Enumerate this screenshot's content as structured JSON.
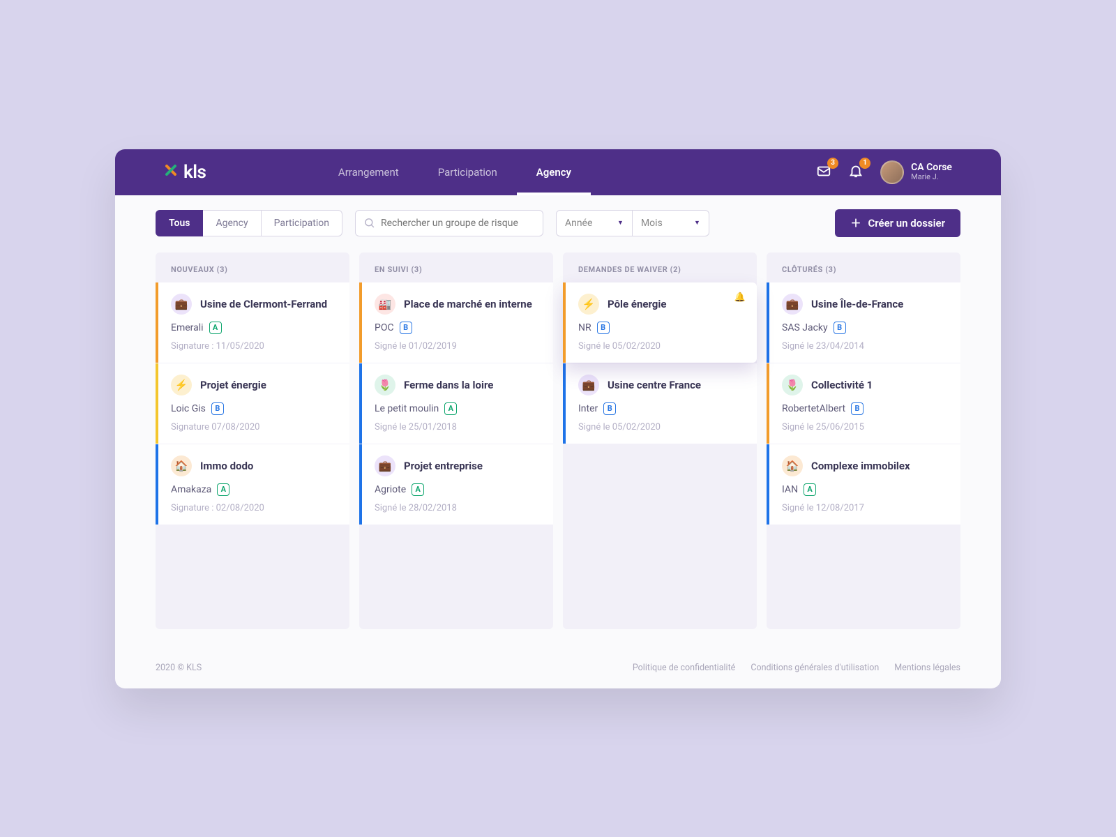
{
  "header": {
    "logo_text": "kls",
    "nav": [
      "Arrangement",
      "Participation",
      "Agency"
    ],
    "nav_active": 2,
    "mail_badge": "3",
    "bell_badge": "1",
    "user_name": "CA Corse",
    "user_sub": "Marie J."
  },
  "toolbar": {
    "tabs": [
      "Tous",
      "Agency",
      "Participation"
    ],
    "tabs_active": 0,
    "search_placeholder": "Rechercher un groupe de risque",
    "select_year": "Année",
    "select_month": "Mois",
    "cta_label": "Créer un dossier"
  },
  "columns": [
    {
      "title": "NOUVEAUX (3)",
      "cards": [
        {
          "border": "bl-orange",
          "ico": "ic-purple",
          "glyph": "💼",
          "title": "Usine de Clermont-Ferrand",
          "client": "Emerali",
          "tag": "A",
          "foot": "Signature : 11/05/2020"
        },
        {
          "border": "bl-yellow",
          "ico": "ic-yellow",
          "glyph": "⚡",
          "title": "Projet énergie",
          "client": "Loic Gis",
          "tag": "B",
          "foot": "Signature 07/08/2020"
        },
        {
          "border": "bl-blue",
          "ico": "ic-orange",
          "glyph": "🏠",
          "title": "Immo dodo",
          "client": "Amakaza",
          "tag": "A",
          "foot": "Signature : 02/08/2020"
        }
      ]
    },
    {
      "title": "EN SUIVI (3)",
      "cards": [
        {
          "border": "bl-orange",
          "ico": "ic-red",
          "glyph": "🏭",
          "title": "Place de marché en interne",
          "client": "POC",
          "tag": "B",
          "foot": "Signé le 01/02/2019"
        },
        {
          "border": "bl-blue",
          "ico": "ic-green",
          "glyph": "🌷",
          "title": "Ferme dans la loire",
          "client": "Le petit moulin",
          "tag": "A",
          "foot": "Signé le 25/01/2018"
        },
        {
          "border": "bl-blue",
          "ico": "ic-purple",
          "glyph": "💼",
          "title": "Projet entreprise",
          "client": "Agriote",
          "tag": "A",
          "foot": "Signé le 28/02/2018"
        }
      ]
    },
    {
      "title": "DEMANDES DE WAIVER (2)",
      "cards": [
        {
          "border": "bl-orange",
          "ico": "ic-yellow",
          "glyph": "⚡",
          "title": "Pôle énergie",
          "client": "NR",
          "tag": "B",
          "foot": "Signé le 05/02/2020",
          "elevated": true,
          "bell": true
        },
        {
          "border": "bl-blue",
          "ico": "ic-purple",
          "glyph": "💼",
          "title": "Usine centre France",
          "client": "Inter",
          "tag": "B",
          "foot": "Signé le 05/02/2020"
        }
      ]
    },
    {
      "title": "CLÔTURÉS (3)",
      "cards": [
        {
          "border": "bl-blue",
          "ico": "ic-purple",
          "glyph": "💼",
          "title": "Usine Île-de-France",
          "client": "SAS Jacky",
          "tag": "B",
          "foot": "Signé le 23/04/2014"
        },
        {
          "border": "bl-orange",
          "ico": "ic-green",
          "glyph": "🌷",
          "title": "Collectivité 1",
          "client": "RobertetAlbert",
          "tag": "B",
          "foot": "Signé le 25/06/2015"
        },
        {
          "border": "bl-blue",
          "ico": "ic-orange",
          "glyph": "🏠",
          "title": "Complexe immobilex",
          "client": "IAN",
          "tag": "A",
          "foot": "Signé le 12/08/2017"
        }
      ]
    }
  ],
  "footer": {
    "copyright": "2020 © KLS",
    "links": [
      "Politique de confidentialité",
      "Conditions générales d'utilisation",
      "Mentions légales"
    ]
  }
}
